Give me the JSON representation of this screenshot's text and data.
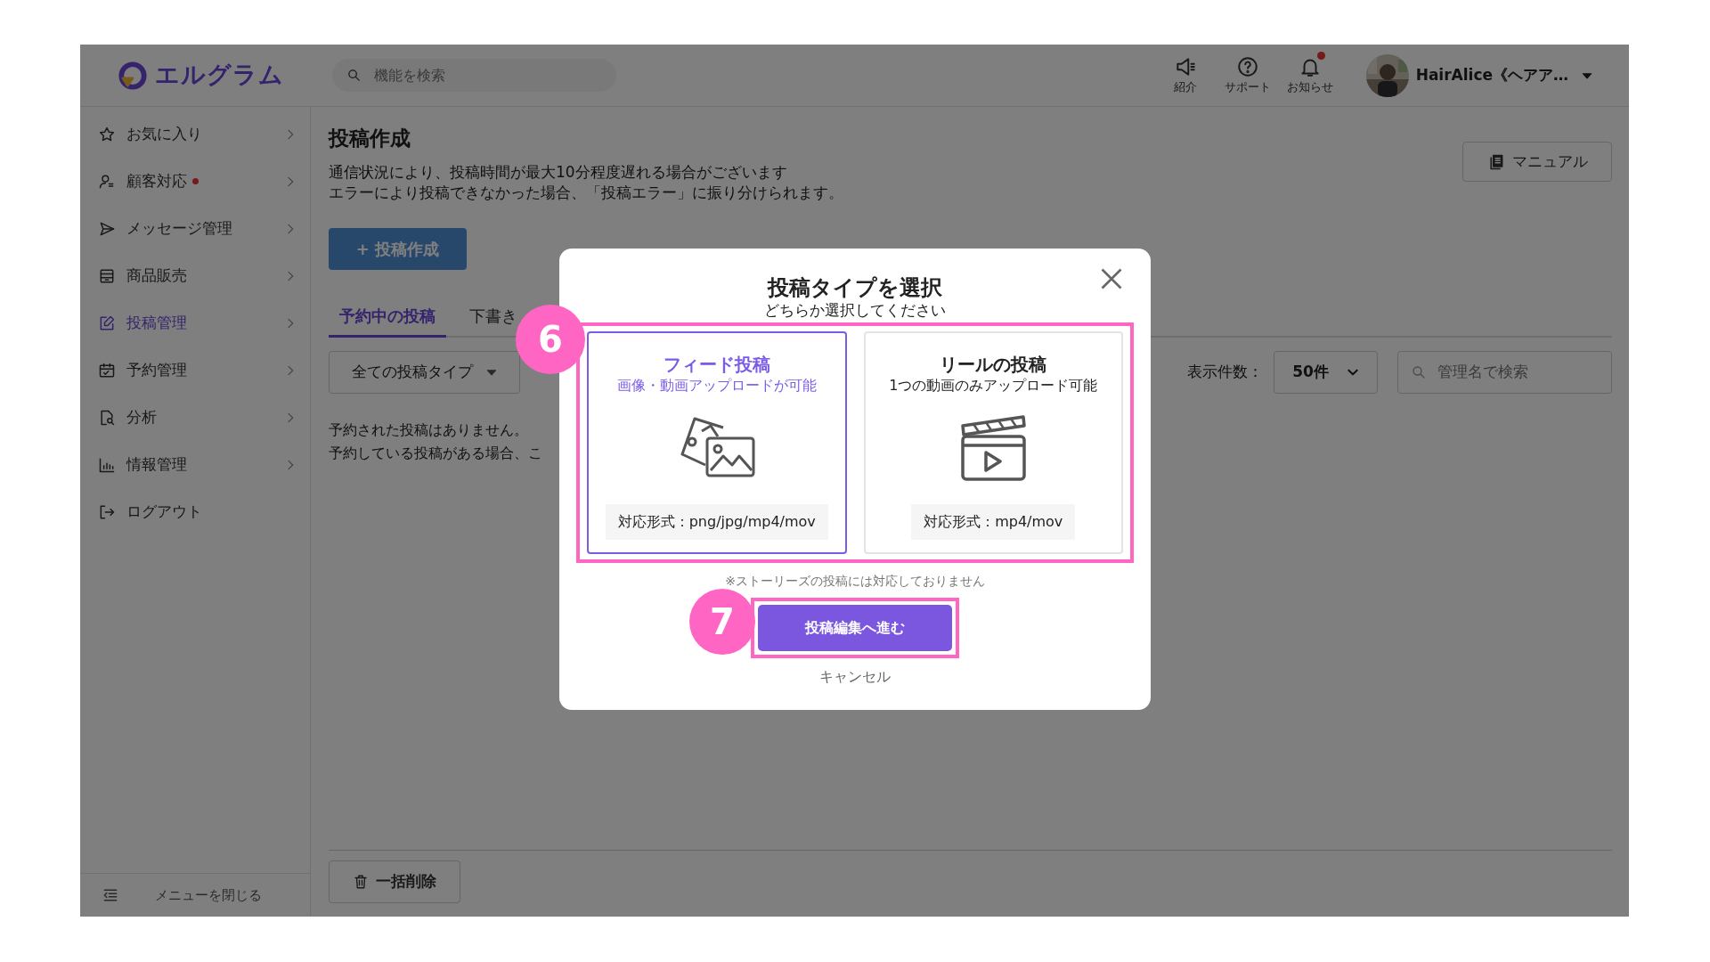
{
  "header": {
    "logo": "エルグラム",
    "search": {
      "placeholder": "機能を検索"
    },
    "actions": [
      {
        "label": "紹介",
        "alert": false
      },
      {
        "label": "サポート",
        "alert": false
      },
      {
        "label": "お知らせ",
        "alert": true
      }
    ],
    "user": {
      "name": "HairAlice《ヘアア…"
    }
  },
  "sidebar": {
    "items": [
      {
        "label": "お気に入り",
        "selected": false,
        "alert": false
      },
      {
        "label": "顧客対応",
        "selected": false,
        "alert": true
      },
      {
        "label": "メッセージ管理",
        "selected": false,
        "alert": false
      },
      {
        "label": "商品販売",
        "selected": false,
        "alert": false
      },
      {
        "label": "投稿管理",
        "selected": true,
        "alert": false
      },
      {
        "label": "予約管理",
        "selected": false,
        "alert": false
      },
      {
        "label": "分析",
        "selected": false,
        "alert": false
      },
      {
        "label": "情報管理",
        "selected": false,
        "alert": false
      },
      {
        "label": "ログアウト",
        "selected": false,
        "alert": false
      }
    ],
    "collapse": "メニューを閉じる"
  },
  "main": {
    "title": "投稿作成",
    "notes": [
      "通信状況により、投稿時間が最大10分程度遅れる場合がございます",
      "エラーにより投稿できなかった場合、「投稿エラー」に振り分けられます。"
    ],
    "create_button": "+ 投稿作成",
    "manual_button": "マニュアル",
    "tabs": [
      {
        "label": "予約中の投稿",
        "selected": true
      },
      {
        "label": "下書き",
        "selected": false
      }
    ],
    "type_filter": "全ての投稿タイプ",
    "per_page_label": "表示件数：",
    "per_page": "50件",
    "search": {
      "placeholder": "管理名で検索"
    },
    "empty": [
      "予約された投稿はありません。",
      "予約している投稿がある場合、こ"
    ],
    "bulk_delete": "一括削除"
  },
  "modal": {
    "title": "投稿タイプを選択",
    "subtitle": "どちらか選択してください",
    "options": [
      {
        "title": "フィード投稿",
        "description": "画像・動画アップロードが可能",
        "formats": "対応形式：png/jpg/mp4/mov",
        "selected": true
      },
      {
        "kind": "video",
        "title": "リールの投稿",
        "description": "1つの動画のみアップロード可能",
        "formats": "対応形式：mp4/mov",
        "selected": false
      }
    ],
    "note": "※ストーリーズの投稿には対応しておりません",
    "primary_button": "投稿編集へ進む",
    "cancel": "キャンセル"
  },
  "annotations": [
    {
      "label": "6"
    },
    {
      "label": "7"
    }
  ]
}
